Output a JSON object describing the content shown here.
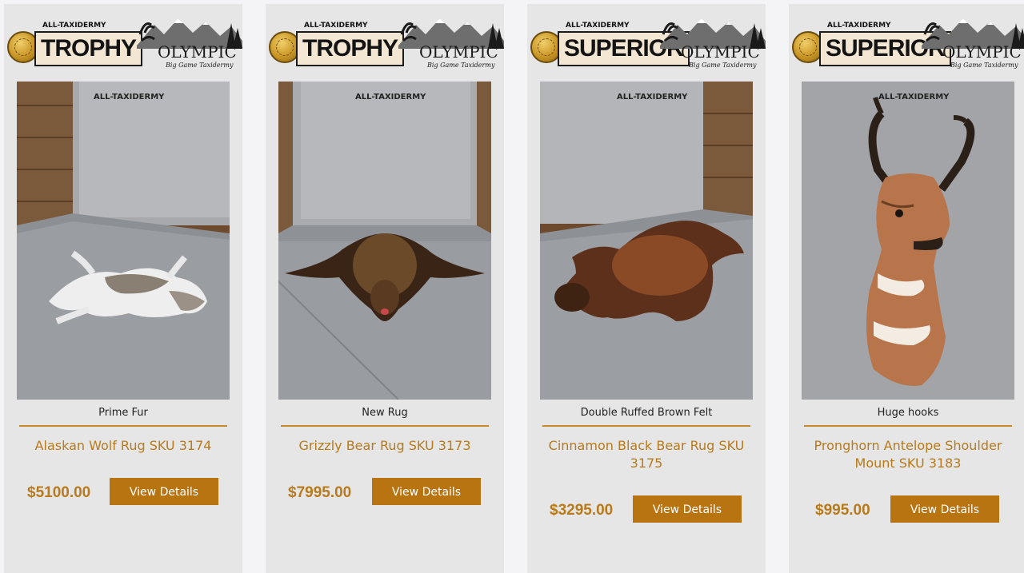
{
  "products": [
    {
      "brand_badge": "TROPHY",
      "brand_mark": "ALL-TAXIDERMY",
      "partner_name": "OLYMPIC",
      "partner_sub": "Big Game Taxidermy",
      "watermark": "ALL-TAXIDERMY",
      "feature": "Prime Fur",
      "title": "Alaskan Wolf Rug SKU 3174",
      "price": "$5100.00",
      "button": "View Details",
      "animal": "wolf-rug"
    },
    {
      "brand_badge": "TROPHY",
      "brand_mark": "ALL-TAXIDERMY",
      "partner_name": "OLYMPIC",
      "partner_sub": "Big Game Taxidermy",
      "watermark": "ALL-TAXIDERMY",
      "feature": "New Rug",
      "title": "Grizzly Bear Rug SKU 3173",
      "price": "$7995.00",
      "button": "View Details",
      "animal": "grizzly-rug"
    },
    {
      "brand_badge": "SUPERIOR",
      "brand_mark": "ALL-TAXIDERMY",
      "partner_name": "OLYMPIC",
      "partner_sub": "Big Game Taxidermy",
      "watermark": "ALL-TAXIDERMY",
      "feature": "Double Ruffed Brown Felt",
      "title": "Cinnamon Black Bear Rug SKU 3175",
      "price": "$3295.00",
      "button": "View Details",
      "animal": "cinnamon-rug"
    },
    {
      "brand_badge": "SUPERIOR",
      "brand_mark": "ALL-TAXIDERMY",
      "partner_name": "OLYMPIC",
      "partner_sub": "Big Game Taxidermy",
      "watermark": "ALL-TAXIDERMY",
      "feature": "Huge hooks",
      "title": "Pronghorn Antelope Shoulder Mount SKU 3183",
      "price": "$995.00",
      "button": "View Details",
      "animal": "pronghorn-mount"
    }
  ],
  "colors": {
    "accent": "#b77410",
    "price": "#b87a1a",
    "card_bg": "#e6e6e6",
    "page_bg": "#f4f4f6"
  }
}
